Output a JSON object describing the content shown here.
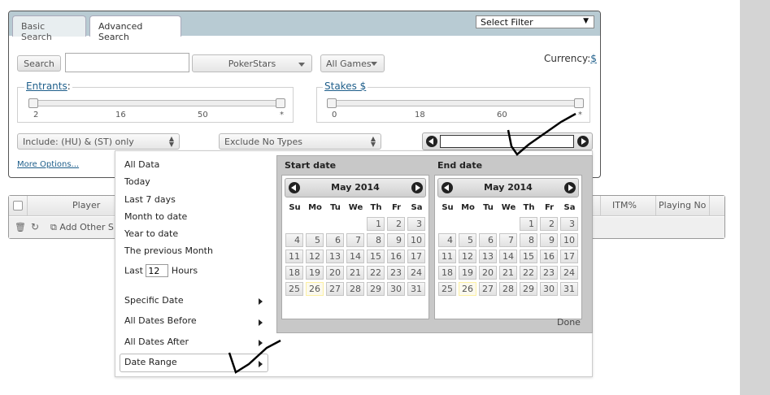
{
  "tabs": [
    {
      "label": "Basic Search"
    },
    {
      "label": "Advanced Search"
    }
  ],
  "filter_select": {
    "value": "Select Filter",
    "arrow": "▼"
  },
  "search": {
    "button": "Search",
    "input_value": ""
  },
  "site_select": {
    "value": "PokerStars"
  },
  "games_select": {
    "value": "All Games"
  },
  "currency": {
    "label": "Currency:",
    "value": "$"
  },
  "entrants": {
    "legend": "Entrants",
    "suffix": ":",
    "ticks": [
      "2",
      "16",
      "50",
      "*"
    ]
  },
  "stakes": {
    "legend": "Stakes $",
    "ticks": [
      "0",
      "18",
      "60",
      "*"
    ]
  },
  "include_select": {
    "value": "Include: (HU) & (ST) only"
  },
  "exclude_select": {
    "value": "Exclude No Types"
  },
  "more_options": "More Options...",
  "grid": {
    "columns": [
      "Player",
      "ITM%",
      "Playing No"
    ],
    "add_other": "Add Other S"
  },
  "date_menu": {
    "options": [
      "All Data",
      "Today",
      "Last 7 days",
      "Month to date",
      "Year to date",
      "The previous Month"
    ],
    "last_label": "Last",
    "last_value": "12",
    "hours_label": "Hours",
    "submenus": [
      "Specific Date",
      "All Dates Before",
      "All Dates After",
      "Date Range"
    ]
  },
  "calendars": {
    "start_label": "Start date",
    "end_label": "End date",
    "month": "May 2014",
    "weekdays": [
      "Su",
      "Mo",
      "Tu",
      "We",
      "Th",
      "Fr",
      "Sa"
    ],
    "first_weekday": 4,
    "days_in_month": 31,
    "today": 26,
    "done": "Done"
  }
}
